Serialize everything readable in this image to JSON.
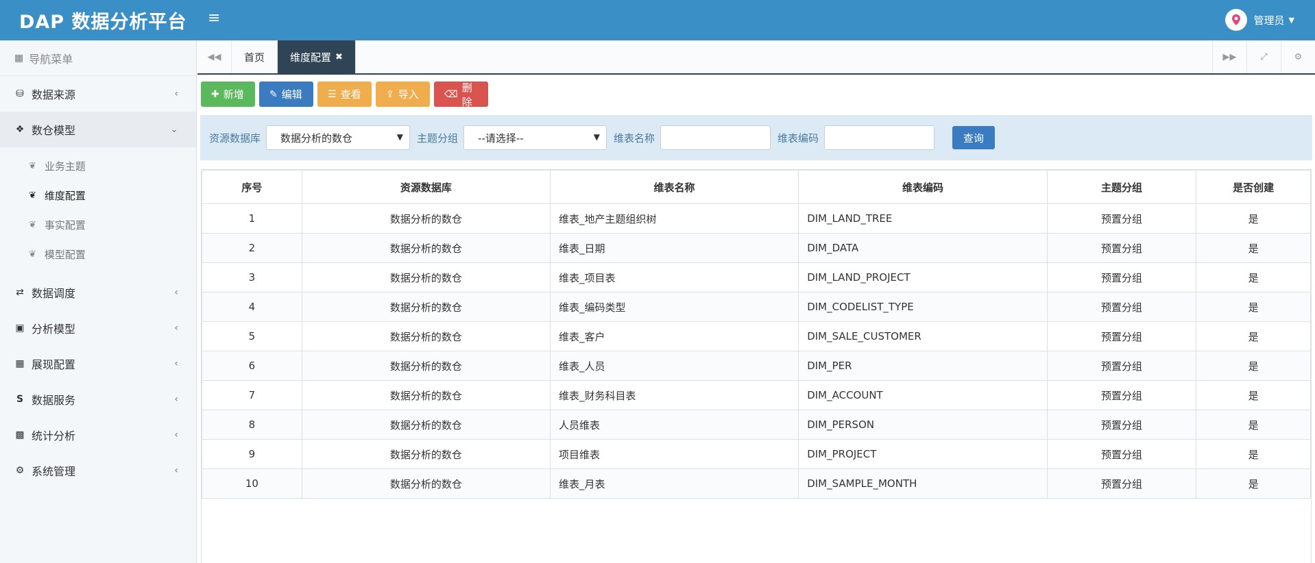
{
  "app": {
    "title": "DAP 数据分析平台",
    "user": "管理员"
  },
  "sidebar": {
    "header": "导航菜单",
    "items": [
      {
        "label": "数据来源",
        "icon": "database-icon"
      },
      {
        "label": "数仓模型",
        "icon": "cubes-icon",
        "expanded": true
      },
      {
        "label": "数据调度",
        "icon": "shuffle-icon"
      },
      {
        "label": "分析模型",
        "icon": "desktop-icon"
      },
      {
        "label": "展现配置",
        "icon": "film-icon"
      },
      {
        "label": "数据服务",
        "icon": "s-icon"
      },
      {
        "label": "统计分析",
        "icon": "bar-chart-icon"
      },
      {
        "label": "系统管理",
        "icon": "gear-icon"
      }
    ],
    "subitems": [
      "业务主题",
      "维度配置",
      "事实配置",
      "模型配置"
    ],
    "current_subitem": "维度配置"
  },
  "tabs": {
    "home": "首页",
    "active": "维度配置"
  },
  "toolbar": {
    "add": "新增",
    "edit": "编辑",
    "view": "查看",
    "import": "导入",
    "delete": "删除"
  },
  "search": {
    "db_label": "资源数据库",
    "db_value": "数据分析的数仓",
    "group_label": "主题分组",
    "group_value": "--请选择--",
    "name_label": "维表名称",
    "name_value": "",
    "code_label": "维表编码",
    "code_value": "",
    "query": "查询"
  },
  "table": {
    "headers": [
      "序号",
      "资源数据库",
      "维表名称",
      "维表编码",
      "主题分组",
      "是否创建"
    ],
    "rows": [
      [
        "1",
        "数据分析的数仓",
        "维表_地产主题组织树",
        "DIM_LAND_TREE",
        "预置分组",
        "是"
      ],
      [
        "2",
        "数据分析的数仓",
        "维表_日期",
        "DIM_DATA",
        "预置分组",
        "是"
      ],
      [
        "3",
        "数据分析的数仓",
        "维表_项目表",
        "DIM_LAND_PROJECT",
        "预置分组",
        "是"
      ],
      [
        "4",
        "数据分析的数仓",
        "维表_编码类型",
        "DIM_CODELIST_TYPE",
        "预置分组",
        "是"
      ],
      [
        "5",
        "数据分析的数仓",
        "维表_客户",
        "DIM_SALE_CUSTOMER",
        "预置分组",
        "是"
      ],
      [
        "6",
        "数据分析的数仓",
        "维表_人员",
        "DIM_PER",
        "预置分组",
        "是"
      ],
      [
        "7",
        "数据分析的数仓",
        "维表_财务科目表",
        "DIM_ACCOUNT",
        "预置分组",
        "是"
      ],
      [
        "8",
        "数据分析的数仓",
        "人员维表",
        "DIM_PERSON",
        "预置分组",
        "是"
      ],
      [
        "9",
        "数据分析的数仓",
        "项目维表",
        "DIM_PROJECT",
        "预置分组",
        "是"
      ],
      [
        "10",
        "数据分析的数仓",
        "维表_月表",
        "DIM_SAMPLE_MONTH",
        "预置分组",
        "是"
      ]
    ]
  },
  "colors": {
    "header": "#3b8fc7",
    "active_tab": "#2f4454",
    "green": "#5cb85c",
    "blue": "#3b7bbf",
    "orange": "#f0ad4e",
    "red": "#d9534f"
  }
}
